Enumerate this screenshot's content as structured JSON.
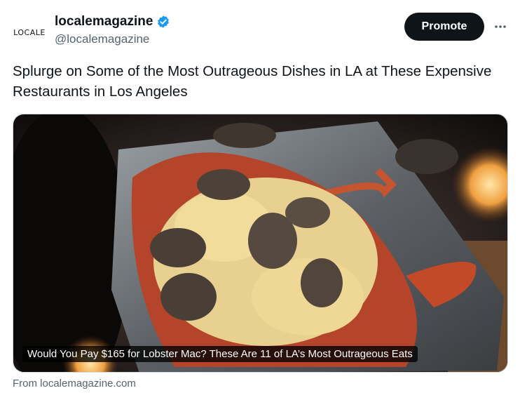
{
  "author": {
    "avatar_text": "LOCALE",
    "display_name": "localemagazine",
    "handle": "@localemagazine",
    "verified_icon": "verified-badge-icon",
    "verified_color": "#1d9bf0"
  },
  "actions": {
    "promote_label": "Promote",
    "more_label": "···"
  },
  "tweet": {
    "text": "Splurge on Some of the Most Outrageous Dishes in LA at These Expensive Restaurants in Los Angeles"
  },
  "card": {
    "caption": "Would You Pay $165 for Lobster Mac? These Are 11 of LA’s Most Outrageous Eats",
    "source": "From localemagazine.com"
  },
  "colors": {
    "text": "#0f1419",
    "secondary": "#536471",
    "button": "#0f1419"
  }
}
